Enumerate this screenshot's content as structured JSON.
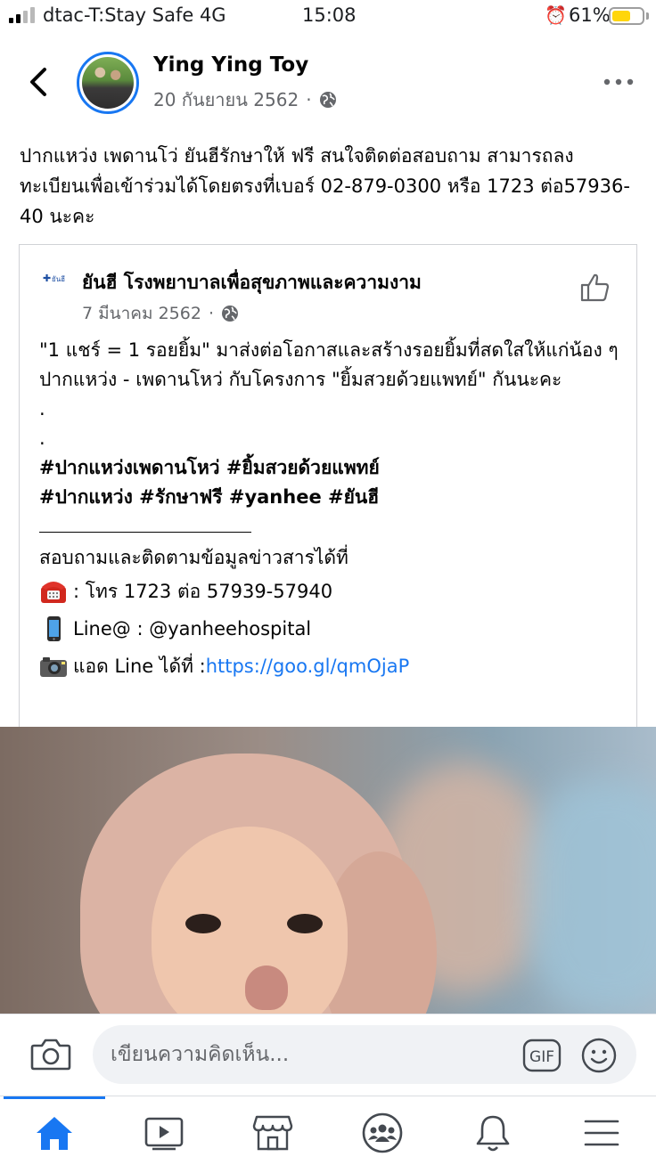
{
  "status_bar": {
    "carrier": "dtac-T:Stay Safe 4G",
    "time": "15:08",
    "battery_percent": "61%",
    "battery_level": 0.61
  },
  "header": {
    "page_name": "Ying Ying Toy",
    "date": "20 กันยายน 2562",
    "separator": "·"
  },
  "post": {
    "text": "ปากแหว่ง เพดานโว่ ยันฮีรักษาให้ ฟรี สนใจติดต่อสอบถาม  สามารถลงทะเบียนเพื่อเข้าร่วมได้โดยตรงที่เบอร์ 02-879-0300 หรือ 1723 ต่อ57936-40 นะคะ"
  },
  "shared_post": {
    "page_name": "ยันฮี โรงพยาบาลเพื่อสุขภาพและความงาม",
    "logo_text": "ยันฮี",
    "date": "7 มีนาคม 2562",
    "separator": "·",
    "body_text": "\"1 แชร์ = 1 รอยยิ้ม\"  มาส่งต่อโอกาสและสร้างรอยยิ้มที่สดใสให้แก่น้อง ๆ ปากแหว่ง - เพดานโหว่ กับโครงการ \"ยิ้มสวยด้วยแพทย์\" กันนะคะ",
    "dot_1": ".",
    "dot_2": ".",
    "hashtags_line1": "#ปากแหว่งเพดานโหว่ #ยิ้มสวยด้วยแพทย์",
    "hashtags_line2": "#ปากแหว่ง #รักษาฟรี #yanhee #ยันฮี",
    "contact_heading": "สอบถามและติดตามข้อมูลข่าวสารได้ที่",
    "phone_line": ": โทร 1723 ต่อ 57939-57940",
    "line_at": "Line@ : @yanheehospital",
    "add_line_label": "แอด Line ได้ที่ : ",
    "add_line_link": "https://goo.gl/qmOjaP"
  },
  "comment_bar": {
    "placeholder": "เขียนความคิดเห็น...",
    "gif_label": "GIF"
  },
  "tabs": [
    {
      "name": "home",
      "icon": "home-icon",
      "active": true
    },
    {
      "name": "watch",
      "icon": "video-icon",
      "active": false
    },
    {
      "name": "marketplace",
      "icon": "marketplace-icon",
      "active": false
    },
    {
      "name": "groups",
      "icon": "groups-icon",
      "active": false
    },
    {
      "name": "notifications",
      "icon": "bell-icon",
      "active": false
    },
    {
      "name": "menu",
      "icon": "menu-icon",
      "active": false
    }
  ],
  "colors": {
    "accent": "#1877f2",
    "secondary_text": "#65676b",
    "battery": "#ffd60a"
  }
}
